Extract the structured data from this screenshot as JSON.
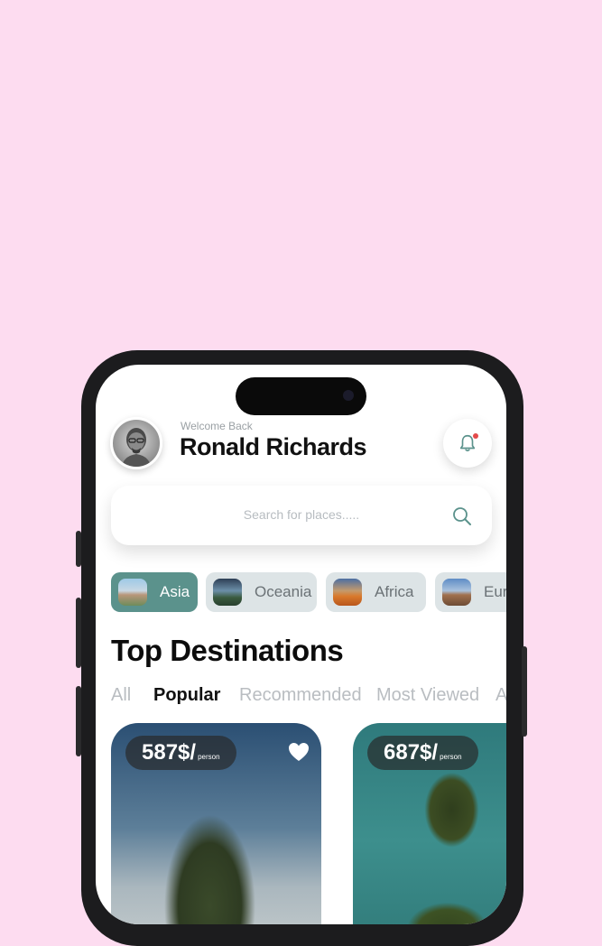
{
  "header": {
    "welcome": "Welcome Back",
    "username": "Ronald Richards"
  },
  "search": {
    "placeholder": "Search for places....."
  },
  "categories": [
    {
      "label": "Asia",
      "active": true
    },
    {
      "label": "Oceania",
      "active": false
    },
    {
      "label": "Africa",
      "active": false
    },
    {
      "label": "Eur",
      "active": false
    }
  ],
  "section": {
    "title": "Top Destinations"
  },
  "filters": [
    "All",
    "Popular",
    "Recommended",
    "Most Viewed",
    "A"
  ],
  "active_filter": "Popular",
  "cards": [
    {
      "price": "587$/",
      "unit": "person",
      "favorited": true
    },
    {
      "price": "687$/",
      "unit": "person",
      "favorited": false
    }
  ],
  "colors": {
    "background": "#fddcf0",
    "accent": "#5b928c",
    "chip": "#dde4e6",
    "notification_dot": "#e34a4a"
  },
  "icons": [
    "bell-icon",
    "search-icon",
    "heart-icon"
  ]
}
